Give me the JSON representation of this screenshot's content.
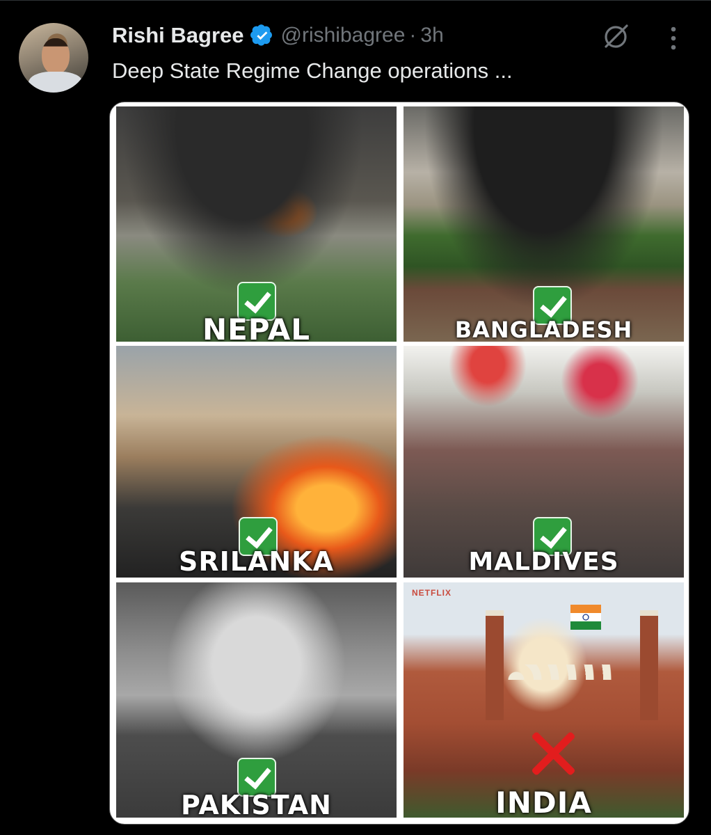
{
  "author": {
    "name": "Rishi Bagree",
    "handle": "@rishibagree",
    "separator": "·",
    "time": "3h"
  },
  "tweet": {
    "text": "Deep State Regime Change operations ..."
  },
  "icons": {
    "verified": "verified-badge-icon",
    "grok": "grok-icon",
    "more": "more-vertical-icon"
  },
  "colors": {
    "background": "#000000",
    "text": "#e7e9ea",
    "muted": "#71767b",
    "verified_blue": "#1d9bf0",
    "check_green": "#2f9e3e",
    "cross_red": "#e21d1d"
  },
  "media": {
    "tiles": [
      {
        "label": "NEPAL",
        "mark": "check"
      },
      {
        "label": "BANGLADESH",
        "mark": "check"
      },
      {
        "label": "SRILANKA",
        "mark": "check"
      },
      {
        "label": "MALDIVES",
        "mark": "check"
      },
      {
        "label": "PAKISTAN",
        "mark": "check"
      },
      {
        "label": "INDIA",
        "mark": "cross"
      }
    ],
    "watermark": "NETFLIX"
  }
}
